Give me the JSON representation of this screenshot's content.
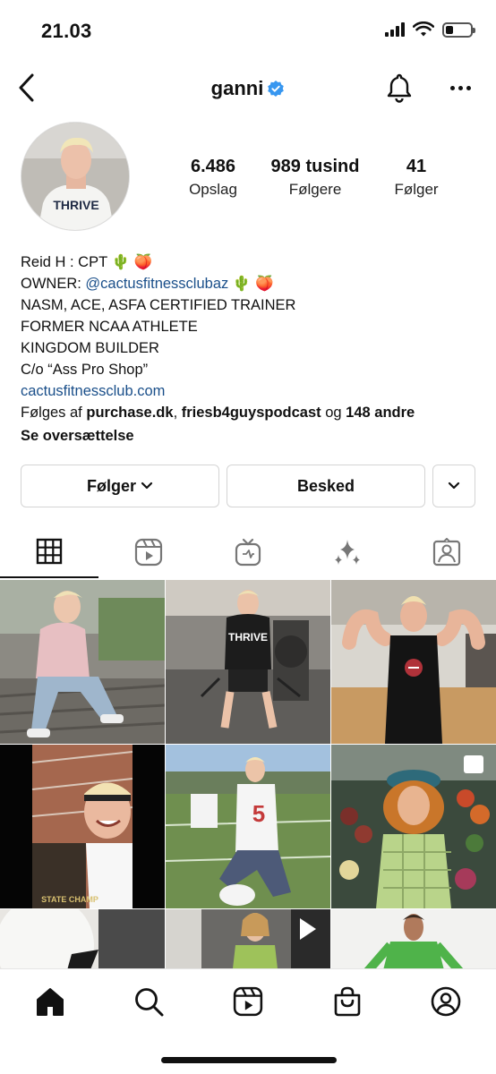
{
  "status": {
    "time": "21.03"
  },
  "header": {
    "username": "ganni"
  },
  "profile": {
    "stats": [
      {
        "value": "6.486",
        "label": "Opslag"
      },
      {
        "value": "989 tusind",
        "label": "Følgere"
      },
      {
        "value": "41",
        "label": "Følger"
      }
    ],
    "avatar_shirt_text": "THRIVE",
    "bio": {
      "name_line": "Reid H : CPT 🌵 🍑",
      "owner_prefix": "OWNER: ",
      "owner_handle": "@cactusfitnessclubaz",
      "owner_emojis": " 🌵 🍑",
      "line3": "NASM, ACE, ASFA CERTIFIED TRAINER",
      "line4": "FORMER NCAA ATHLETE",
      "line5": "KINGDOM BUILDER",
      "line6": "C/o “Ass Pro Shop”",
      "website": "cactusfitnessclub.com",
      "followed_prefix": "Følges af ",
      "followed_user1": "purchase.dk",
      "followed_sep": ", ",
      "followed_user2": "friesb4guyspodcast",
      "followed_mid": " og ",
      "followed_count": "148 andre",
      "translate": "Se oversættelse"
    }
  },
  "actions": {
    "following_label": "Følger",
    "message_label": "Besked"
  },
  "grid": {
    "tile_texts": [
      "THRIVE",
      "THRIVE",
      "STATE CHAMP"
    ]
  },
  "colors": {
    "verified_blue": "#3897f0",
    "link_blue": "#1a4f8a",
    "border_grey": "#d4d4d4"
  },
  "icons": {
    "tabs": [
      "grid-icon",
      "reels-icon",
      "igtv-icon",
      "sparkles-icon",
      "tagged-icon"
    ],
    "nav": [
      "home-icon",
      "search-icon",
      "reels-icon",
      "shop-icon",
      "profile-icon"
    ]
  }
}
